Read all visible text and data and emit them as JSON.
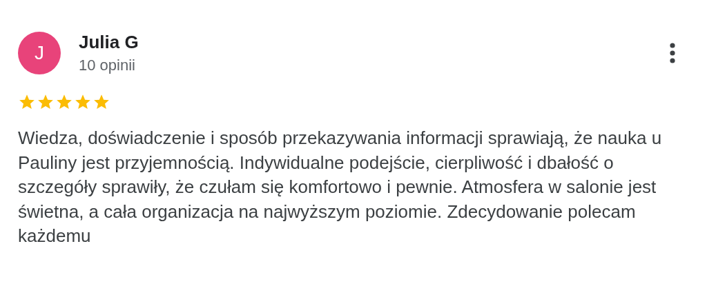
{
  "review": {
    "avatar_letter": "J",
    "author": "Julia G",
    "review_count": "10 opinii",
    "stars": 5,
    "text": "Wiedza, doświadczenie i sposób przekazywania informacji sprawiają, że nauka u Pauliny jest przyjemnością. Indywidualne podejście, cierpliwość i dbałość o szczegóły sprawiły, że czułam się komfortowo i pewnie. Atmosfera w salonie jest świetna, a cała organizacja na najwyższym poziomie. Zdecydowanie polecam każdemu"
  }
}
